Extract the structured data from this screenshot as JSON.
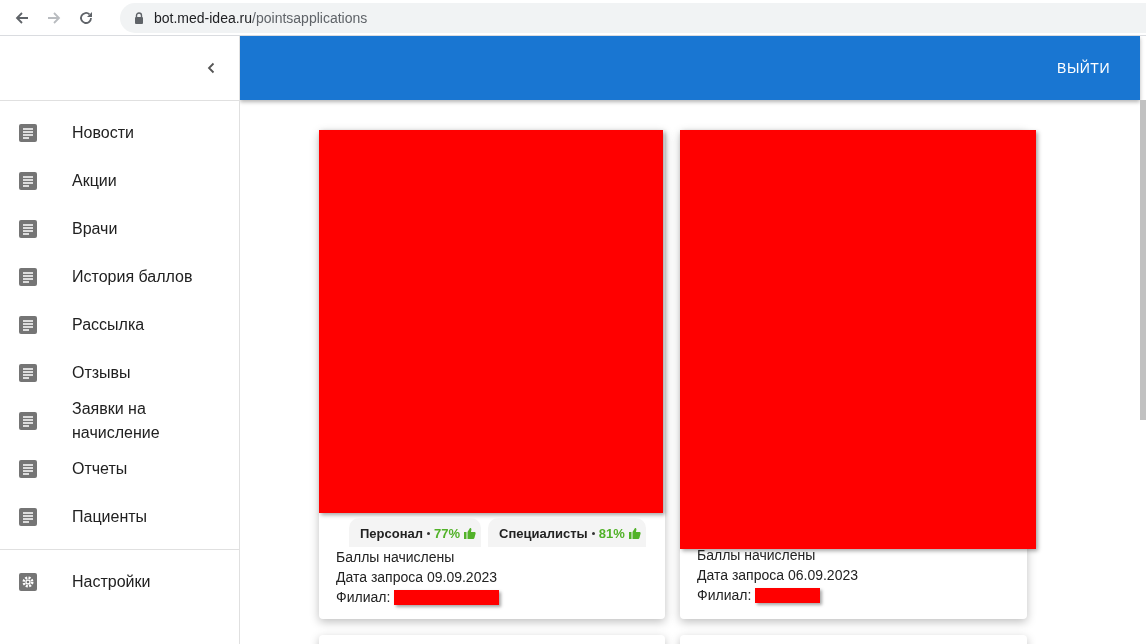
{
  "browser": {
    "url_host": "bot.med-idea.ru",
    "url_path": "/pointsapplications"
  },
  "header": {
    "logout": "ВЫЙТИ"
  },
  "sidebar": {
    "items": [
      {
        "label": "Новости",
        "kind": "page",
        "selected": false
      },
      {
        "label": "Акции",
        "kind": "page",
        "selected": false
      },
      {
        "label": "Врачи",
        "kind": "page",
        "selected": false
      },
      {
        "label": "История баллов",
        "kind": "page",
        "selected": false
      },
      {
        "label": "Рассылка",
        "kind": "page",
        "selected": false
      },
      {
        "label": "Отзывы",
        "kind": "page",
        "selected": false
      },
      {
        "label": "Заявки на начисление",
        "kind": "page",
        "selected": false
      },
      {
        "label": "Отчеты",
        "kind": "page",
        "selected": false
      },
      {
        "label": "Пациенты",
        "kind": "page",
        "selected": false
      }
    ],
    "footer_items": [
      {
        "label": "Настройки",
        "kind": "settings",
        "selected": false
      }
    ]
  },
  "cards": [
    {
      "ratings": [
        {
          "label": "Персонал",
          "value": "77%"
        },
        {
          "label": "Специалисты",
          "value": "81%"
        }
      ],
      "status": "Баллы начислены",
      "date": "Дата запроса 09.09.2023",
      "branch_label": "Филиал:"
    },
    {
      "status": "Баллы начислены",
      "date": "Дата запроса 06.09.2023",
      "branch_label": "Филиал:"
    }
  ]
}
